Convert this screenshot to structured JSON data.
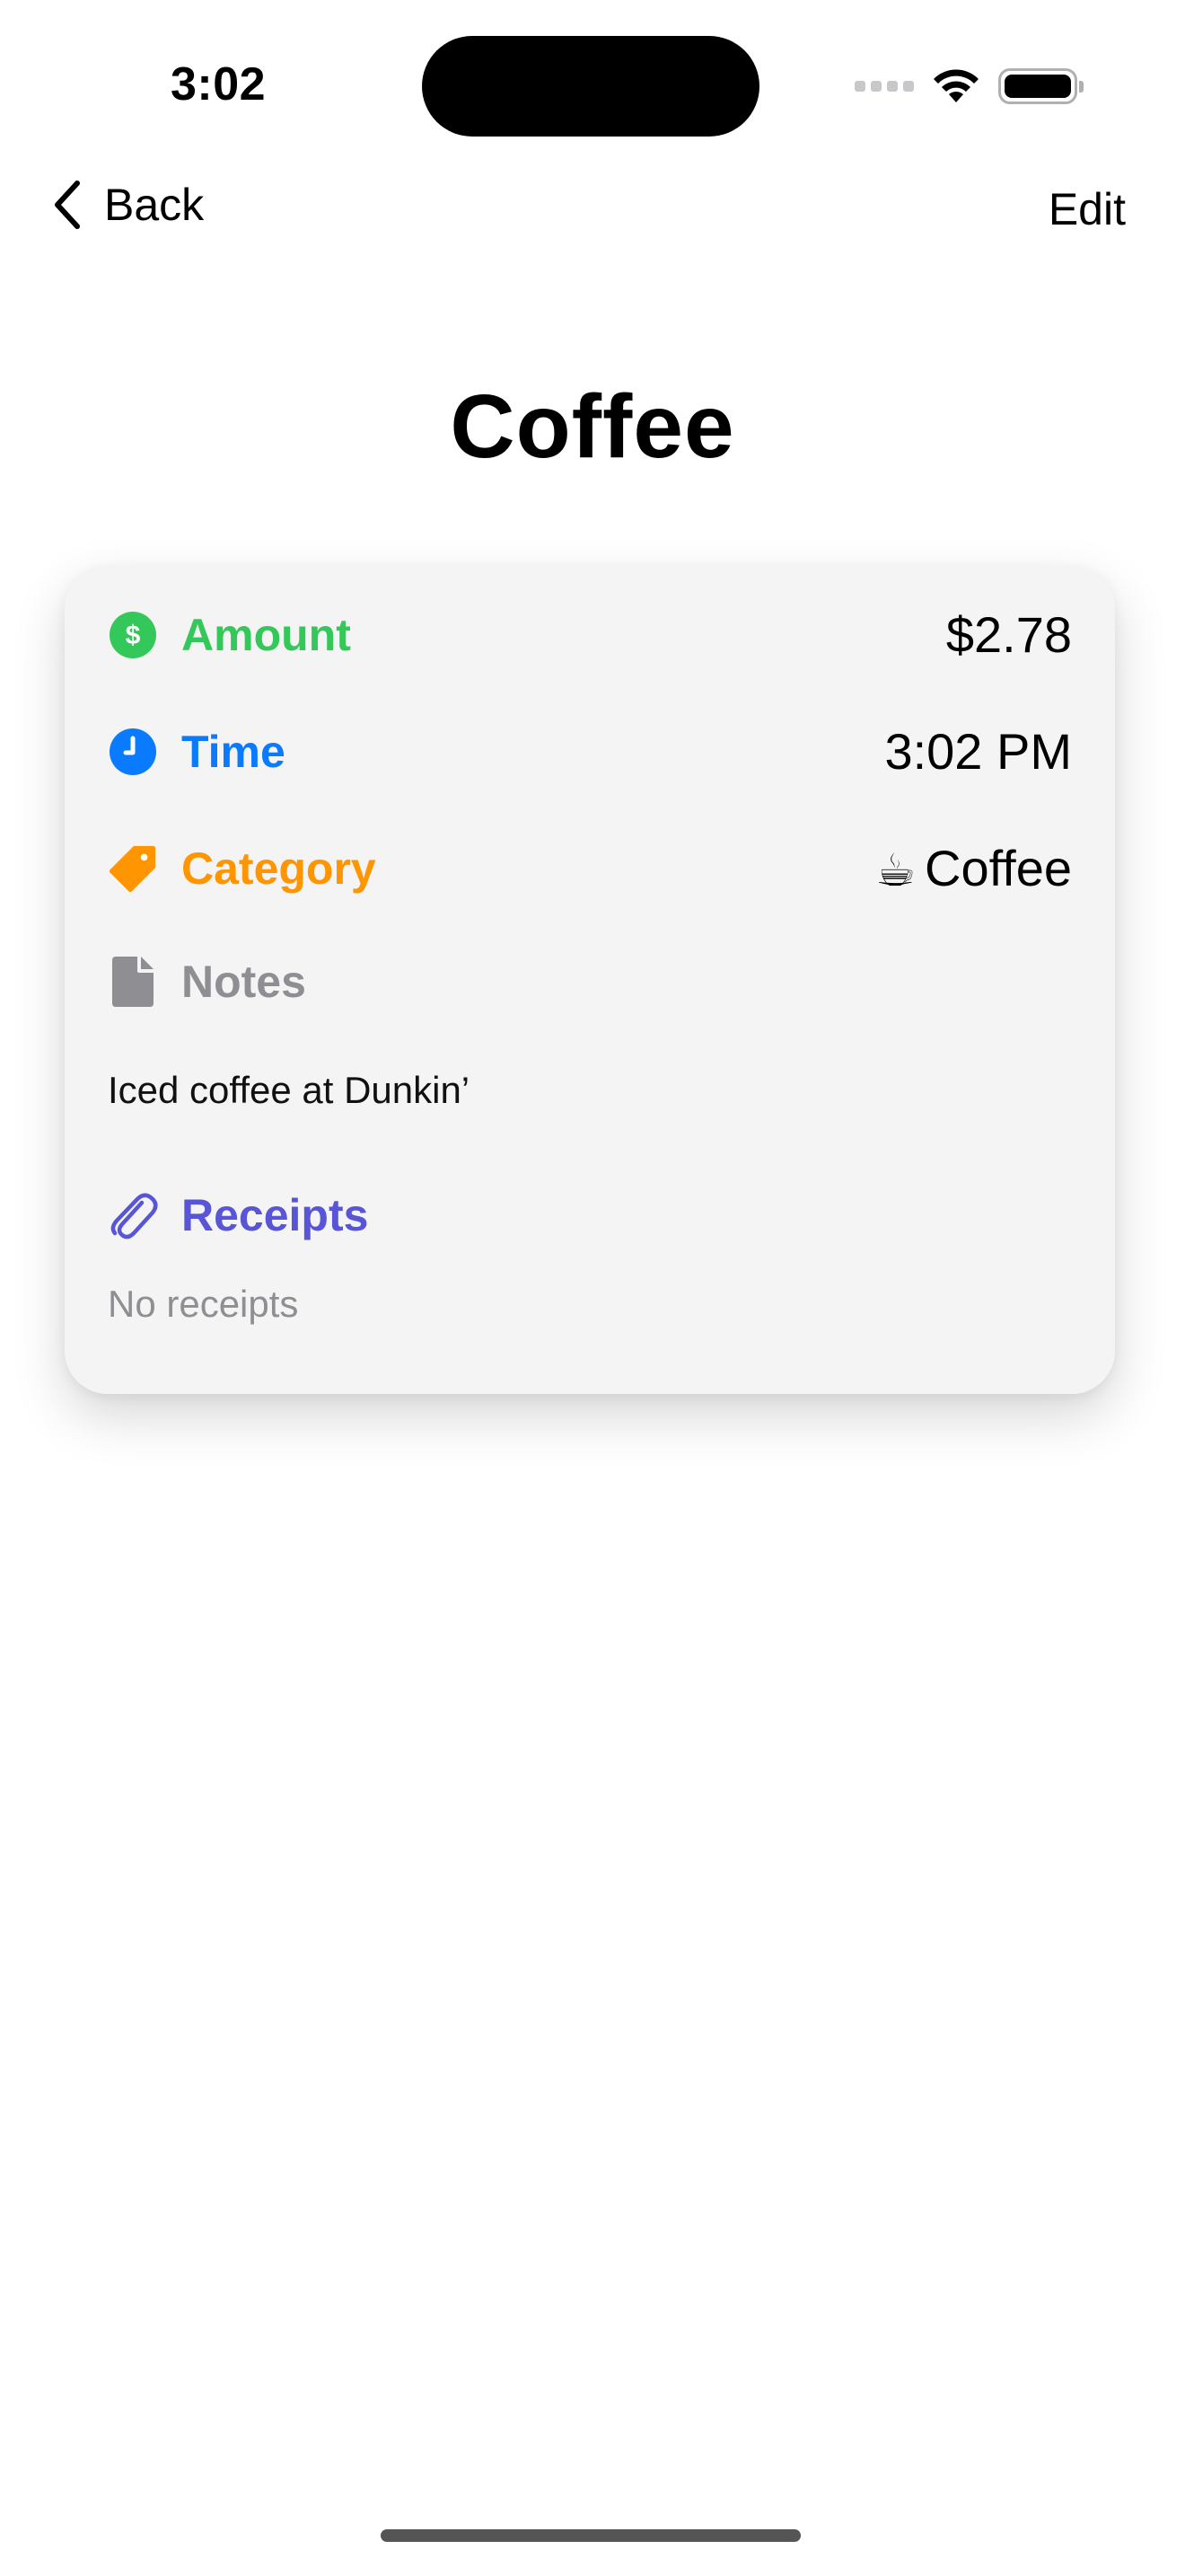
{
  "status_bar": {
    "time": "3:02"
  },
  "nav": {
    "back_label": "Back",
    "edit_label": "Edit"
  },
  "title": "Coffee",
  "details": {
    "amount": {
      "label": "Amount",
      "value": "$2.78",
      "color": "#34c759"
    },
    "time": {
      "label": "Time",
      "value": "3:02 PM",
      "color": "#0a7aff"
    },
    "category": {
      "label": "Category",
      "emoji": "☕",
      "value": "Coffee",
      "color": "#ff9500"
    },
    "notes": {
      "label": "Notes",
      "text": "Iced coffee at Dunkin’",
      "color": "#8e8e93"
    },
    "receipts": {
      "label": "Receipts",
      "empty_text": "No receipts",
      "color": "#5856d6"
    }
  },
  "icons": {
    "amount": "dollar-circle-icon",
    "time": "clock-icon",
    "category": "tag-icon",
    "notes": "document-icon",
    "receipts": "paperclip-icon"
  }
}
